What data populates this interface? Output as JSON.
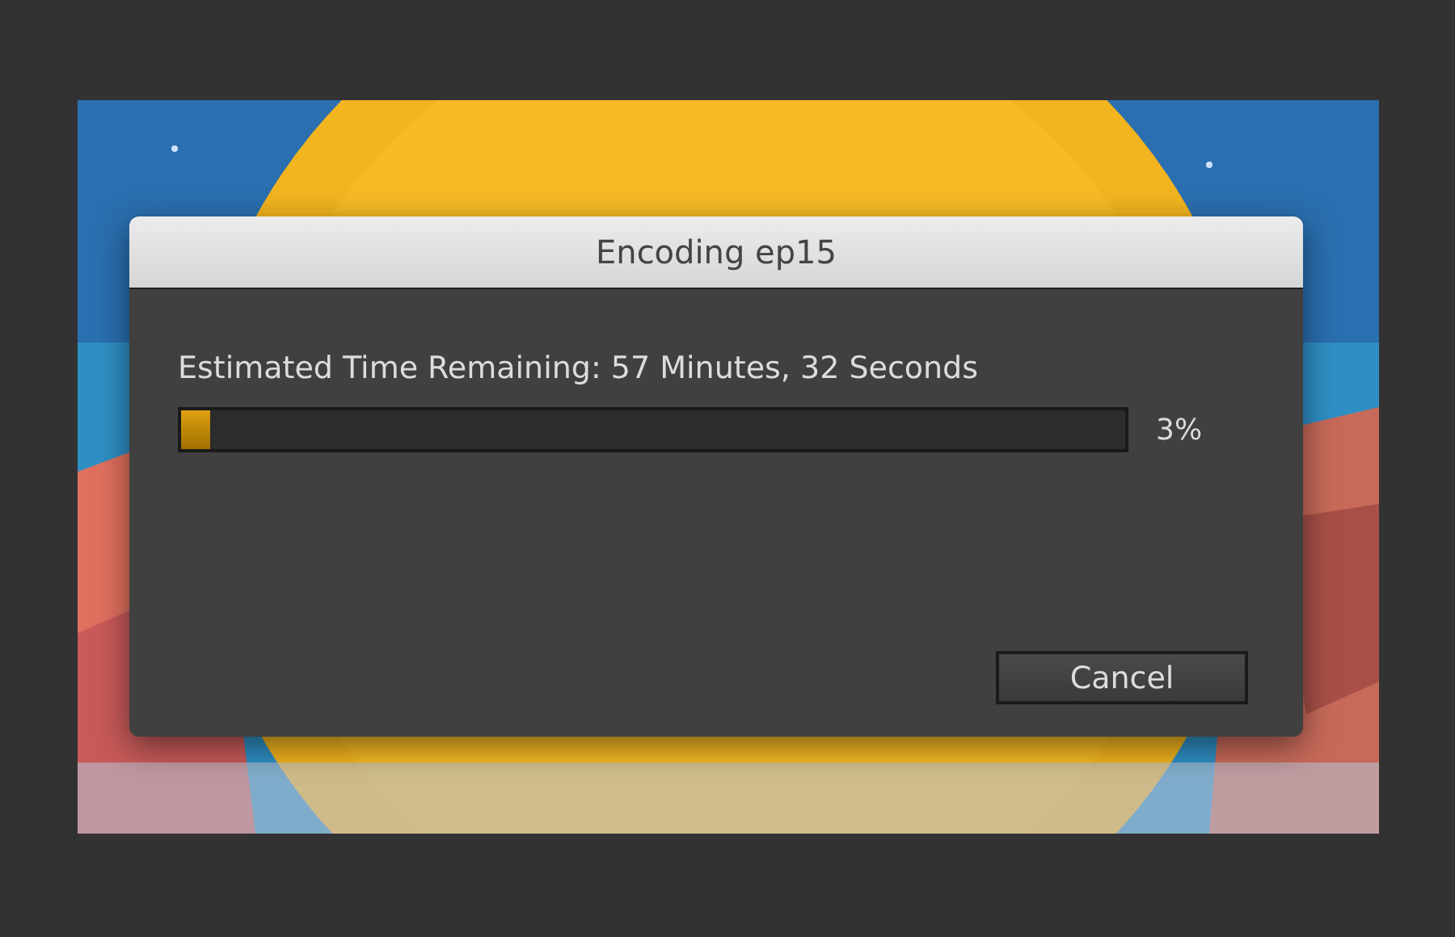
{
  "dialog": {
    "title": "Encoding ep15",
    "message": "Estimated Time Remaining: 57 Minutes, 32 Seconds",
    "progress": {
      "level": 0.03,
      "reading": "3%"
    },
    "buttons": [
      "Cancel"
    ]
  }
}
